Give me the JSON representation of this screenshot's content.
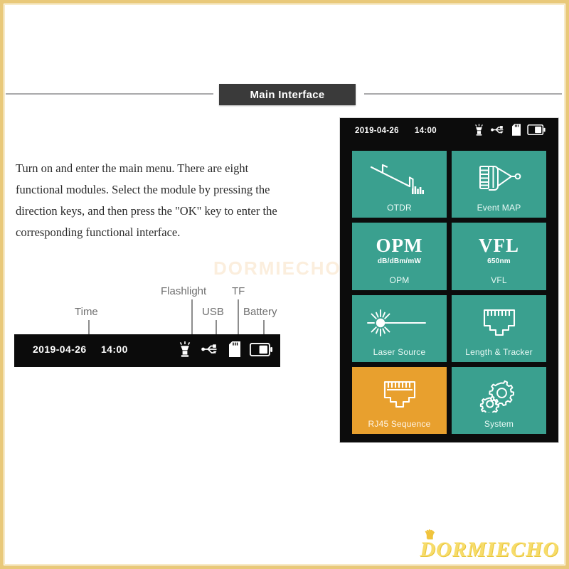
{
  "header": {
    "title": "Main Interface"
  },
  "description": {
    "paragraph": "Turn on and enter the main menu. There are eight functional modules. Select the module by pressing the direction keys, and then press the \"OK\" key to enter the corresponding functional interface."
  },
  "watermark": {
    "center_text": "DORMIECHO",
    "logo_text": "DORMIECHO",
    "logo_crown": "♛"
  },
  "annotations": {
    "labels": [
      {
        "text": "Time",
        "icon": "time-label"
      },
      {
        "text": "Flashlight",
        "icon": "flashlight-label"
      },
      {
        "text": "USB",
        "icon": "usb-label"
      },
      {
        "text": "TF",
        "icon": "tf-label"
      },
      {
        "text": "Battery",
        "icon": "battery-label"
      }
    ]
  },
  "example_status_bar": {
    "date": "2019-04-26",
    "time": "14:00",
    "icons": [
      "flashlight-icon",
      "usb-icon",
      "tf-card-icon",
      "battery-icon"
    ]
  },
  "device": {
    "status_bar": {
      "date": "2019-04-26",
      "time": "14:00",
      "icons": [
        "flashlight-icon",
        "usb-icon",
        "tf-card-icon",
        "battery-icon"
      ]
    },
    "selected_tile": "RJ45 Sequence",
    "colors": {
      "tile": "#3aa08f",
      "tile_selected": "#e8a02e",
      "screen_background": "#0c0c0c",
      "label": "#eafaf6"
    },
    "tiles": [
      {
        "label": "OTDR",
        "icon": "otdr-trace-icon",
        "big": "",
        "sub": "",
        "selected": false
      },
      {
        "label": "Event MAP",
        "icon": "event-map-icon",
        "big": "",
        "sub": "",
        "selected": false
      },
      {
        "label": "OPM",
        "icon": "text-icon",
        "big": "OPM",
        "sub": "dB/dBm/mW",
        "selected": false
      },
      {
        "label": "VFL",
        "icon": "text-icon",
        "big": "VFL",
        "sub": "650nm",
        "selected": false
      },
      {
        "label": "Laser Source",
        "icon": "laser-source-icon",
        "big": "",
        "sub": "",
        "selected": false
      },
      {
        "label": "Length & Tracker",
        "icon": "rj45-port-icon",
        "big": "",
        "sub": "",
        "selected": false
      },
      {
        "label": "RJ45 Sequence",
        "icon": "rj45-port-icon",
        "big": "",
        "sub": "",
        "selected": true
      },
      {
        "label": "System",
        "icon": "gears-icon",
        "big": "",
        "sub": "",
        "selected": false
      }
    ]
  }
}
